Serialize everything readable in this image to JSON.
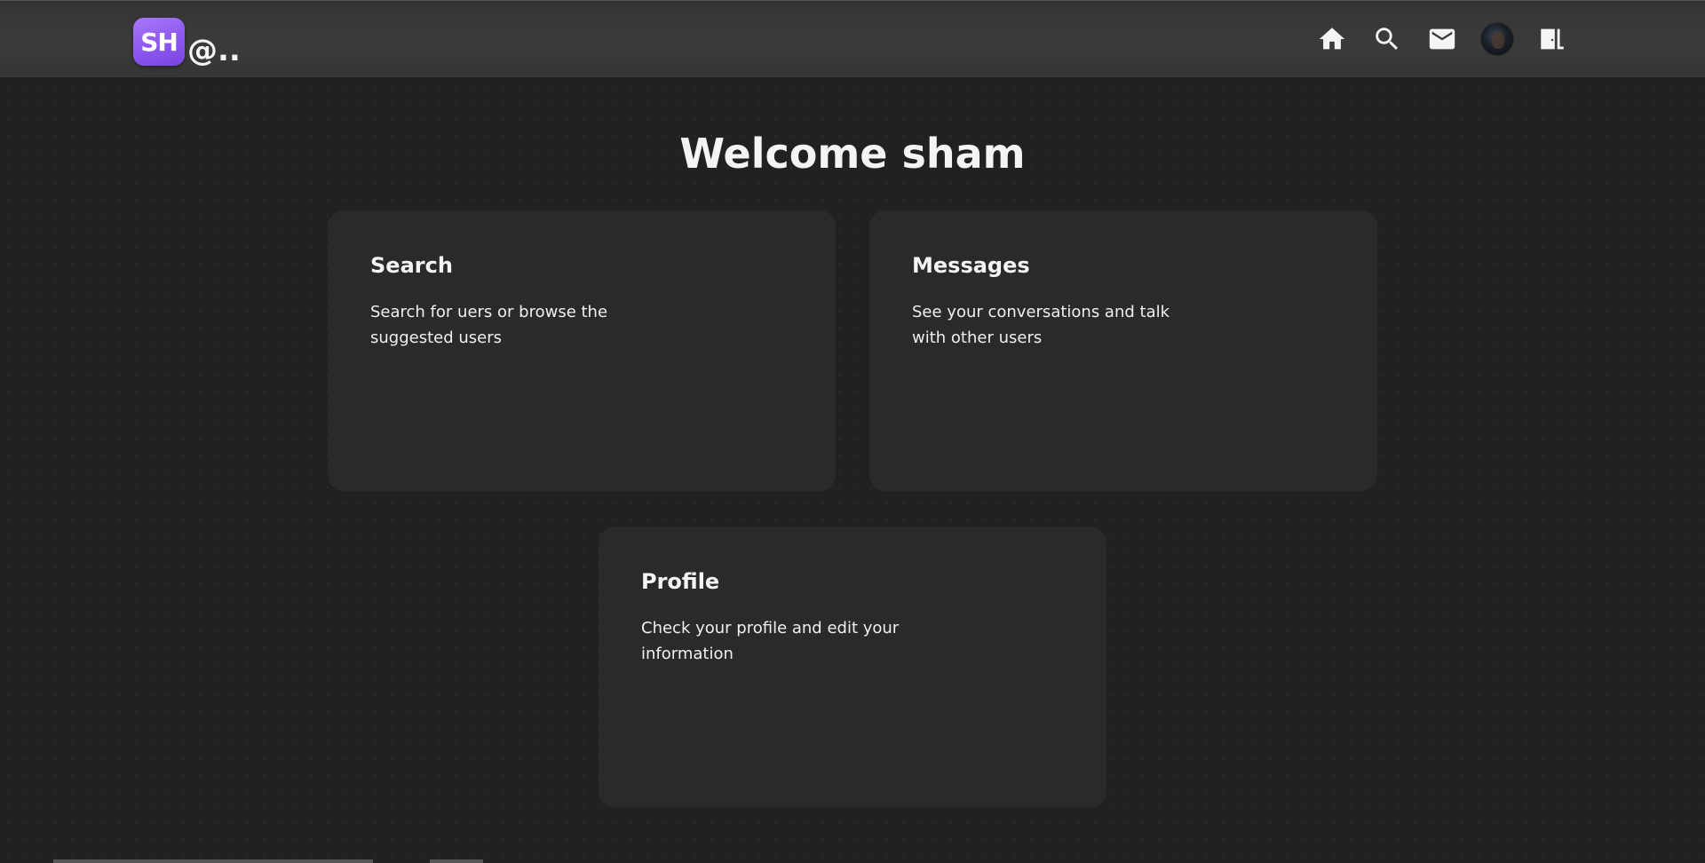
{
  "navbar": {
    "brand": {
      "badge": "SH",
      "suffix": "@.."
    },
    "icons": [
      {
        "name": "home-icon",
        "label": "Home"
      },
      {
        "name": "search-icon",
        "label": "Search"
      },
      {
        "name": "mail-icon",
        "label": "Messages"
      },
      {
        "name": "avatar",
        "label": "Profile"
      },
      {
        "name": "logout-icon",
        "label": "Logout"
      }
    ]
  },
  "welcome": {
    "title": "Welcome sham"
  },
  "cards": {
    "search": {
      "title": "Search",
      "description": "Search for uers or browse the suggested users"
    },
    "messages": {
      "title": "Messages",
      "description": "See your conversations and talk with other users"
    },
    "profile": {
      "title": "Profile",
      "description": "Check your profile and edit your information"
    }
  },
  "colors": {
    "accent": "#8a55ee",
    "navbar": "#3a3a3a",
    "background": "#212121",
    "card": "#303030"
  }
}
